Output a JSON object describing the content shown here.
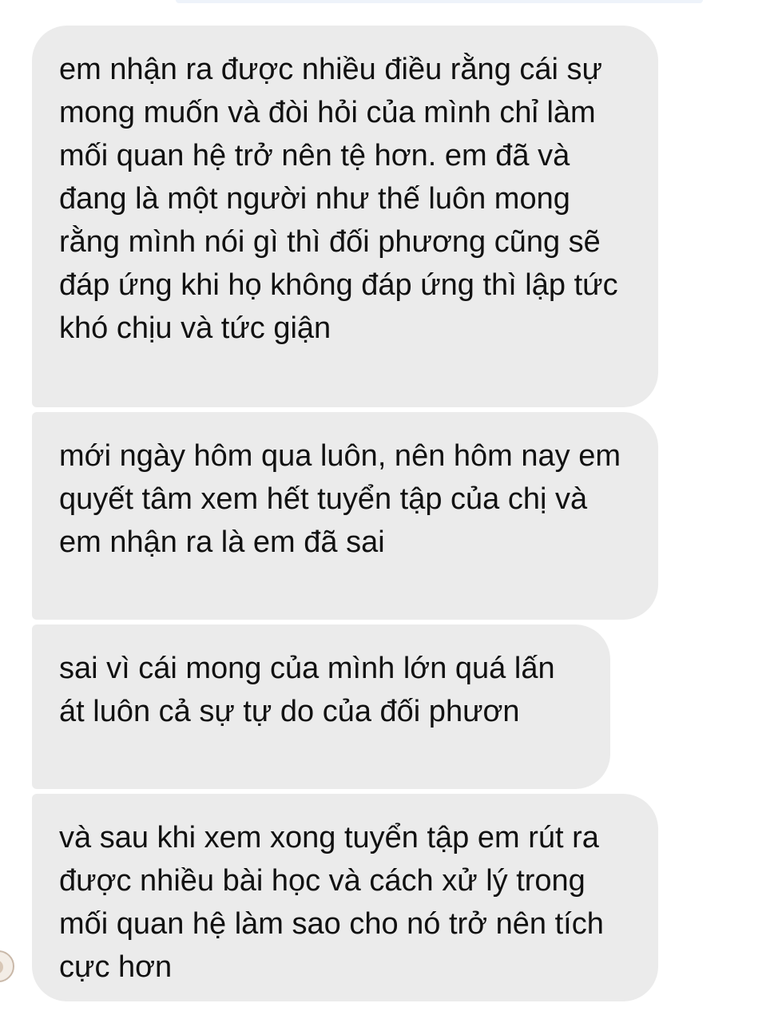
{
  "messages": [
    {
      "text": "em nhận ra được nhiều điều rằng cái sự mong muốn và đòi hỏi của mình chỉ làm mối quan hệ trở nên tệ hơn. em đã  và đang là một người như thế luôn mong rằng mình nói gì thì đối phương cũng sẽ đáp ứng khi họ không đáp ứng thì lập tức khó chịu và tức giận"
    },
    {
      "text": "mới ngày hôm qua luôn, nên hôm nay em quyết tâm xem hết tuyển tập của chị và em nhận ra là em đã sai"
    },
    {
      "text": "sai vì cái mong của mình lớn quá lấn át luôn cả sự tự do của đối phươn"
    },
    {
      "text": "và sau khi xem xong tuyển tập em rút ra được nhiều bài học và cách xử lý trong mối quan hệ làm sao cho nó trở nên tích cực hơn"
    }
  ],
  "colors": {
    "bubble_bg": "#ebebeb",
    "text": "#111111",
    "background": "#ffffff"
  },
  "icons": {
    "avatar": "avatar-icon"
  }
}
